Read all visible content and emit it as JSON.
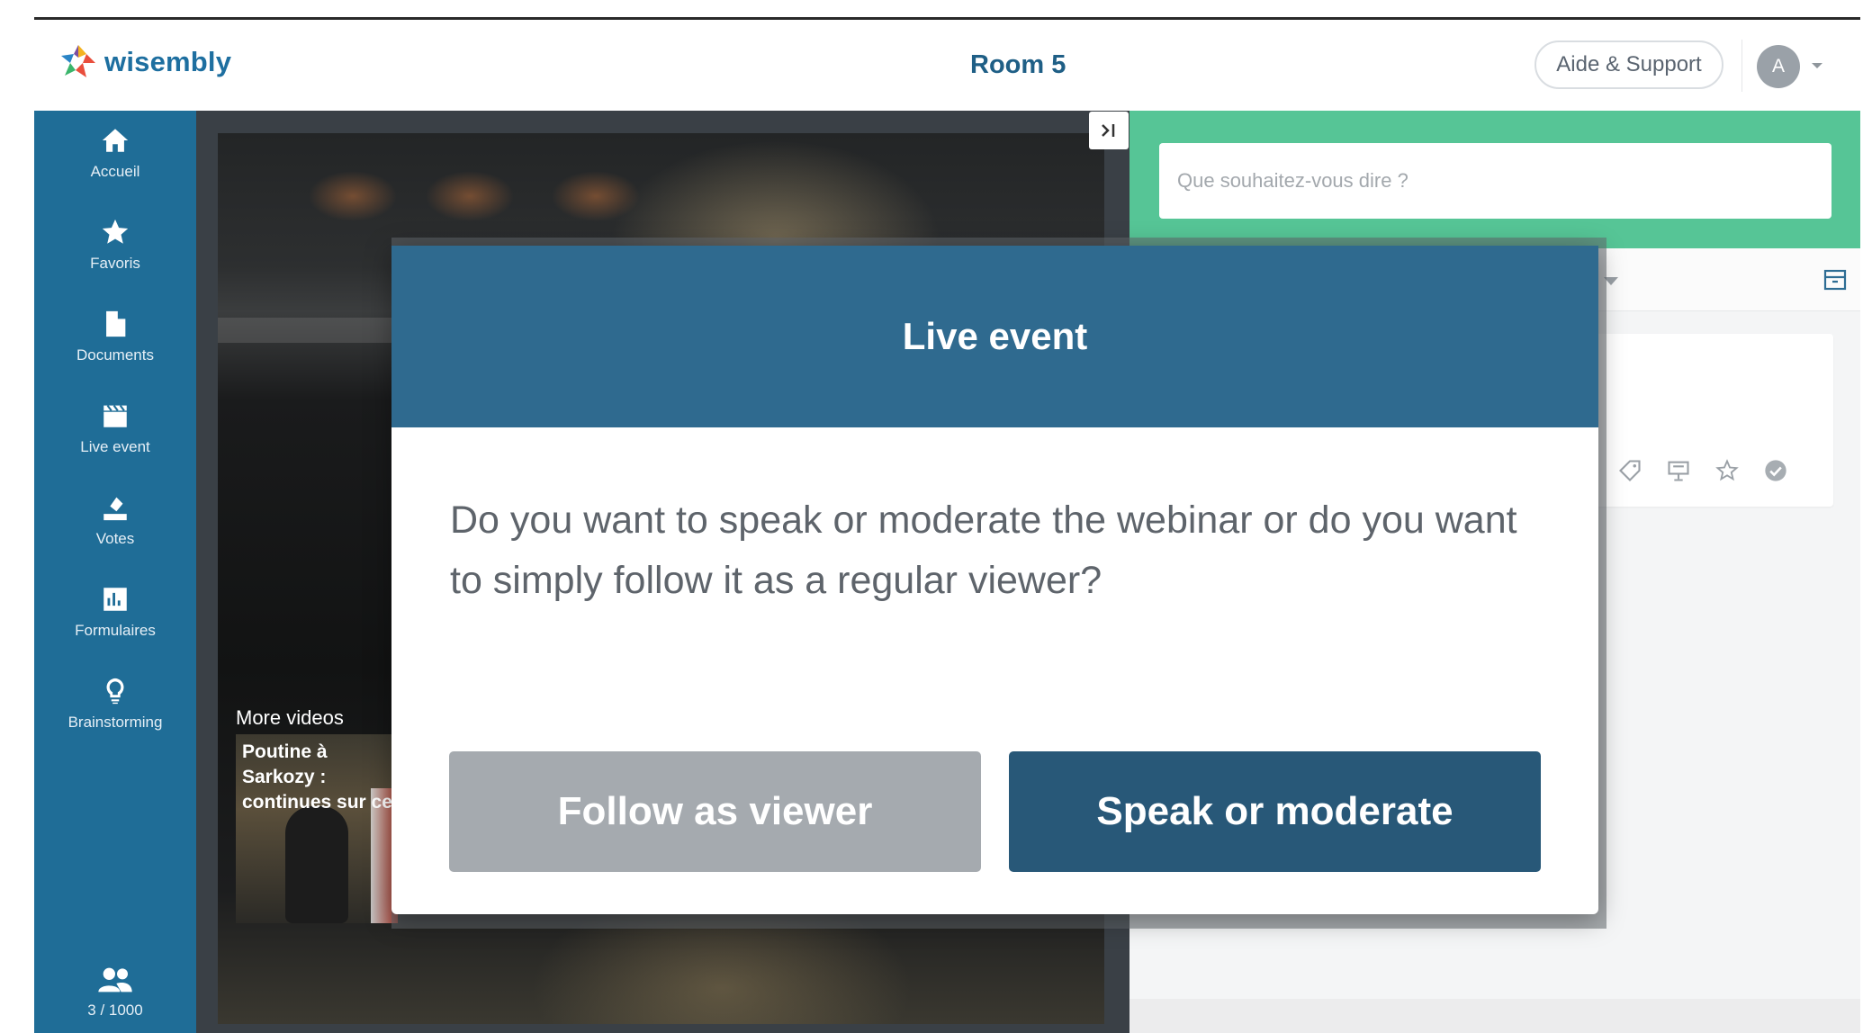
{
  "header": {
    "logo_text": "wisembly",
    "room_title": "Room 5",
    "support_label": "Aide & Support",
    "avatar_initial": "A"
  },
  "sidebar": {
    "items": [
      {
        "label": "Accueil",
        "icon": "home-icon"
      },
      {
        "label": "Favoris",
        "icon": "star-icon"
      },
      {
        "label": "Documents",
        "icon": "document-icon"
      },
      {
        "label": "Live event",
        "icon": "clapperboard-icon"
      },
      {
        "label": "Votes",
        "icon": "vote-icon"
      },
      {
        "label": "Formulaires",
        "icon": "bar-chart-icon"
      },
      {
        "label": "Brainstorming",
        "icon": "lightbulb-icon"
      }
    ],
    "users_count": "3 / 1000",
    "bg_color": "#1f6d97"
  },
  "video": {
    "more_videos_label": "More videos",
    "thumb_title": "Poutine à Sarkozy : continues sur ce"
  },
  "right_panel": {
    "ask_placeholder": "Que souhaitez-vous dire ?",
    "ask_bar_color": "#56c596"
  },
  "modal": {
    "title": "Live event",
    "question": "Do you want to speak or moderate the webinar or do you want to simply follow it as a regular viewer?",
    "viewer_button": "Follow as viewer",
    "speak_button": "Speak or moderate",
    "header_color": "#2f6a8f",
    "speak_color": "#285878",
    "viewer_color": "#a5aaaf"
  }
}
